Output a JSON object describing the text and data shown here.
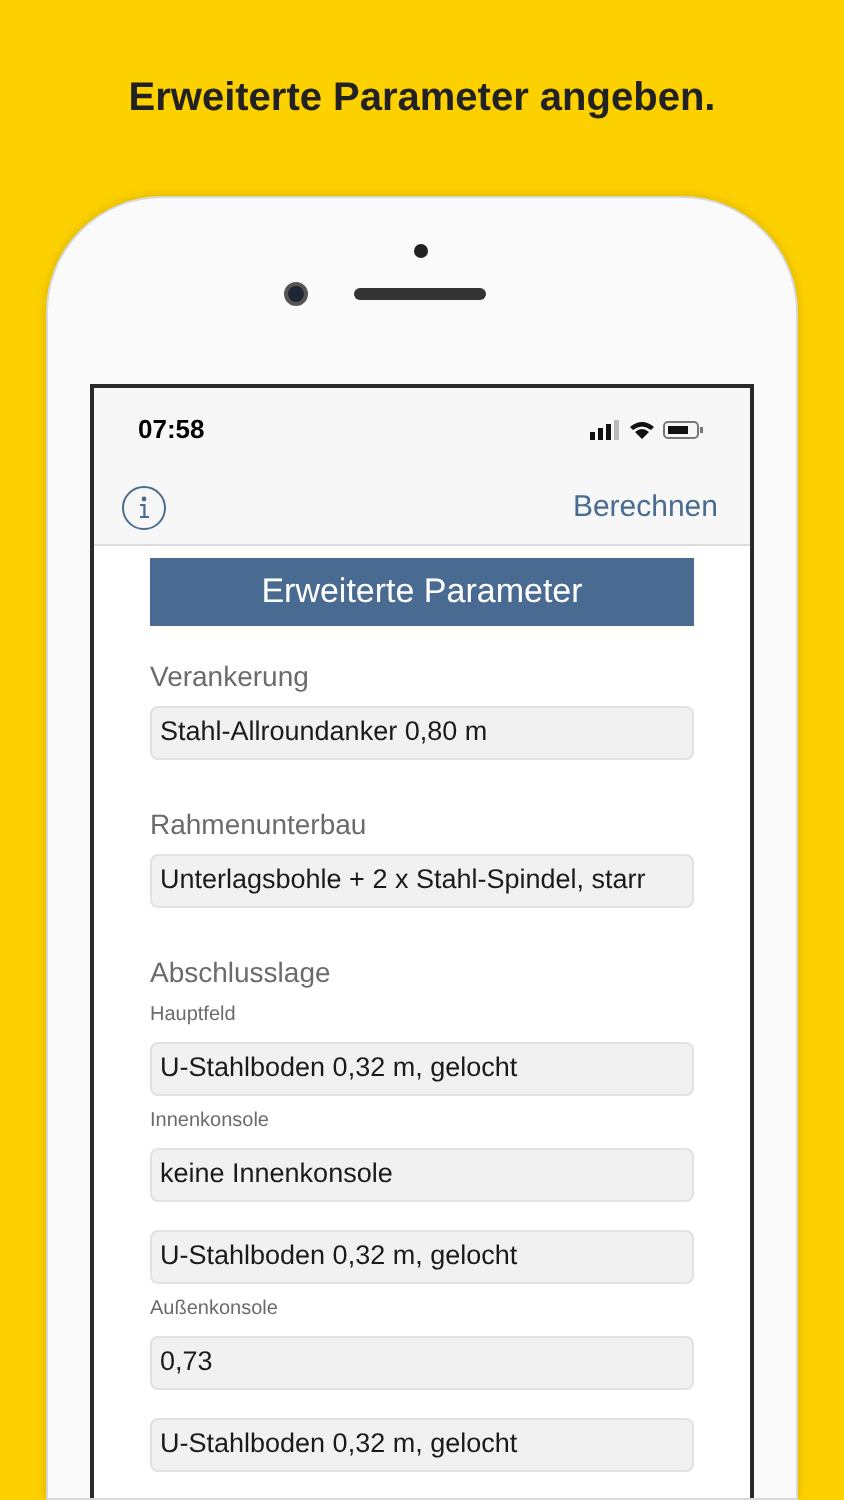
{
  "headline": "Erweiterte Parameter angeben.",
  "status_bar": {
    "time": "07:58"
  },
  "nav": {
    "action": "Berechnen"
  },
  "banner": "Erweiterte Parameter",
  "items": [
    {
      "kind": "section",
      "text": "Verankerung"
    },
    {
      "kind": "field",
      "text": "Stahl-Allroundanker 0,80 m"
    },
    {
      "kind": "section",
      "text": "Rahmenunterbau"
    },
    {
      "kind": "field",
      "text": "Unterlagsbohle + 2 x Stahl-Spindel, starr"
    },
    {
      "kind": "section",
      "text": "Abschlusslage"
    },
    {
      "kind": "sublabel",
      "text": "Hauptfeld"
    },
    {
      "kind": "field",
      "text": "U-Stahlboden 0,32 m, gelocht"
    },
    {
      "kind": "sublabel",
      "text": "Innenkonsole"
    },
    {
      "kind": "field",
      "text": "keine Innenkonsole"
    },
    {
      "kind": "field",
      "text": "U-Stahlboden 0,32 m, gelocht"
    },
    {
      "kind": "sublabel",
      "text": "Außenkonsole"
    },
    {
      "kind": "field",
      "text": "0,73"
    },
    {
      "kind": "field",
      "text": "U-Stahlboden 0,32 m, gelocht"
    }
  ]
}
